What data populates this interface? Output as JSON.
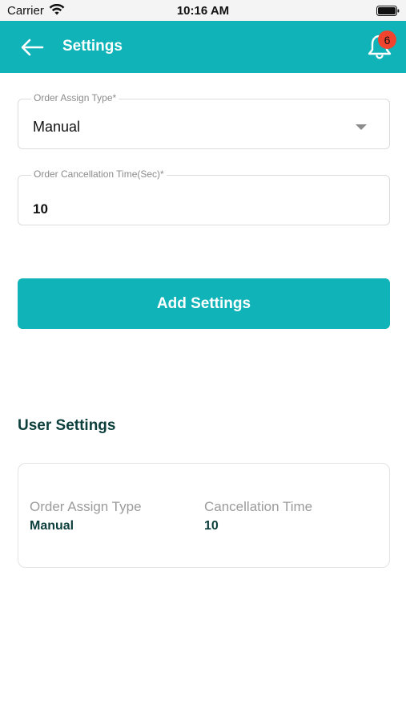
{
  "status_bar": {
    "carrier": "Carrier",
    "time": "10:16 AM"
  },
  "app_bar": {
    "title": "Settings",
    "notification_count": "6",
    "background_color": "#10b4b8",
    "badge_color": "#f0442f"
  },
  "form": {
    "order_assign_type": {
      "label": "Order Assign Type*",
      "value": "Manual"
    },
    "order_cancellation_time": {
      "label": "Order Cancellation Time(Sec)*",
      "value": "10"
    },
    "submit_label": "Add Settings"
  },
  "user_settings": {
    "title": "User Settings",
    "order_assign_type_label": "Order Assign Type",
    "order_assign_type_value": "Manual",
    "cancellation_time_label": "Cancellation Time",
    "cancellation_time_value": "10",
    "title_color": "#0c3f3c"
  },
  "icons": {
    "back": "arrow-left-icon",
    "notifications": "bell-icon",
    "dropdown": "caret-down-icon",
    "wifi": "wifi-icon",
    "battery": "battery-icon"
  }
}
